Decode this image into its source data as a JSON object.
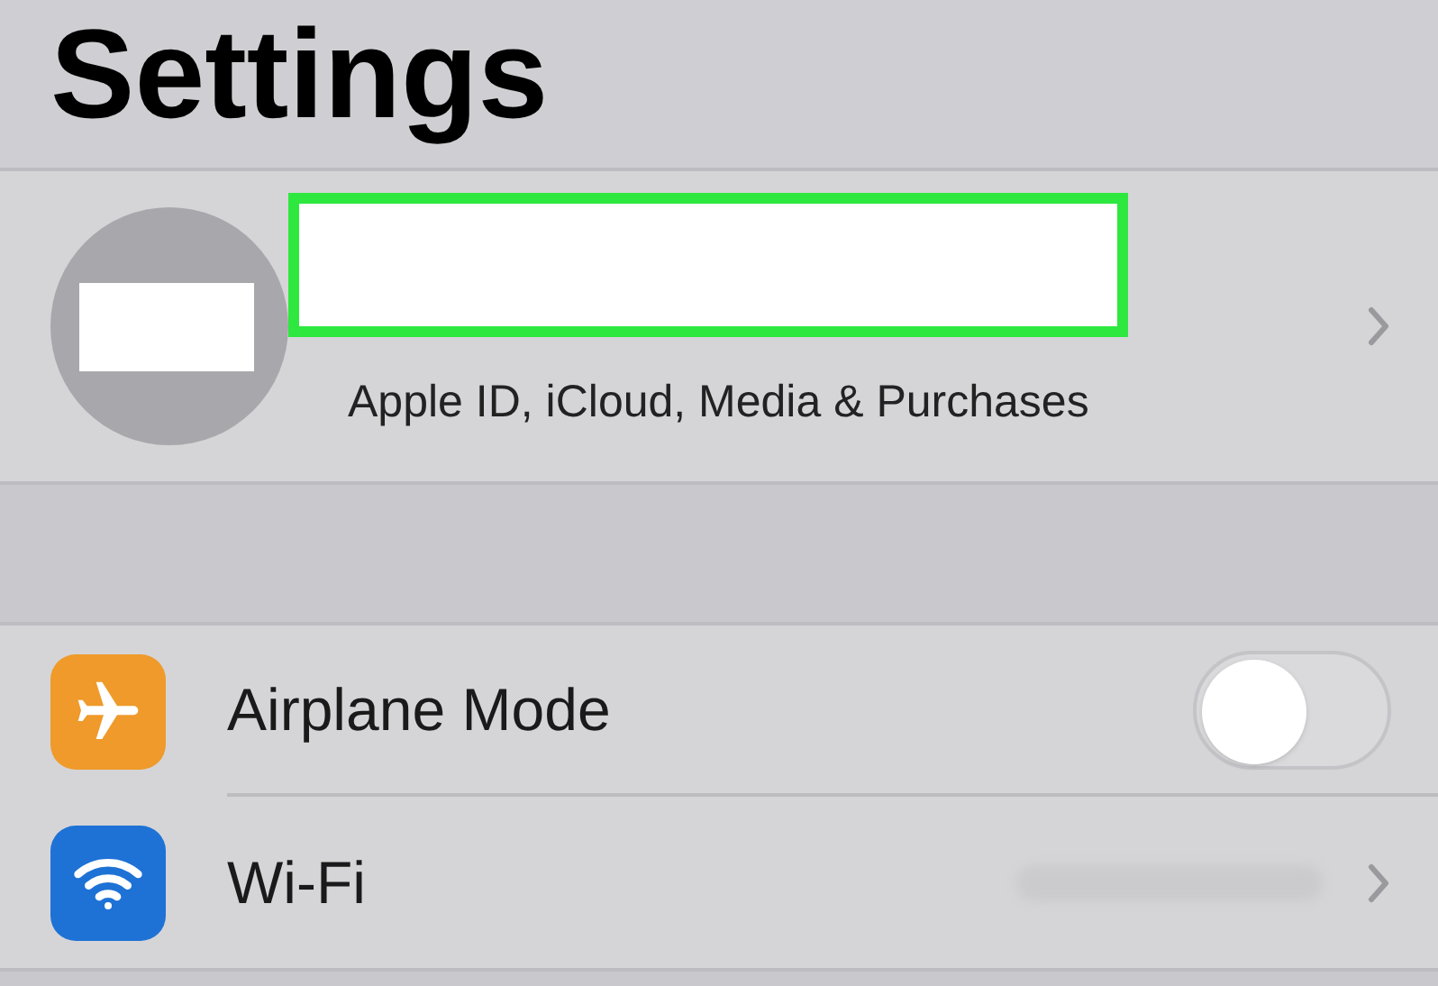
{
  "title": "Settings",
  "profile": {
    "subtitle": "Apple ID, iCloud, Media & Purchases"
  },
  "rows": [
    {
      "kind": "toggle",
      "label": "Airplane Mode",
      "color": "#ef9a2b",
      "on": false
    },
    {
      "kind": "link",
      "label": "Wi-Fi",
      "color": "#1e72d6"
    }
  ]
}
